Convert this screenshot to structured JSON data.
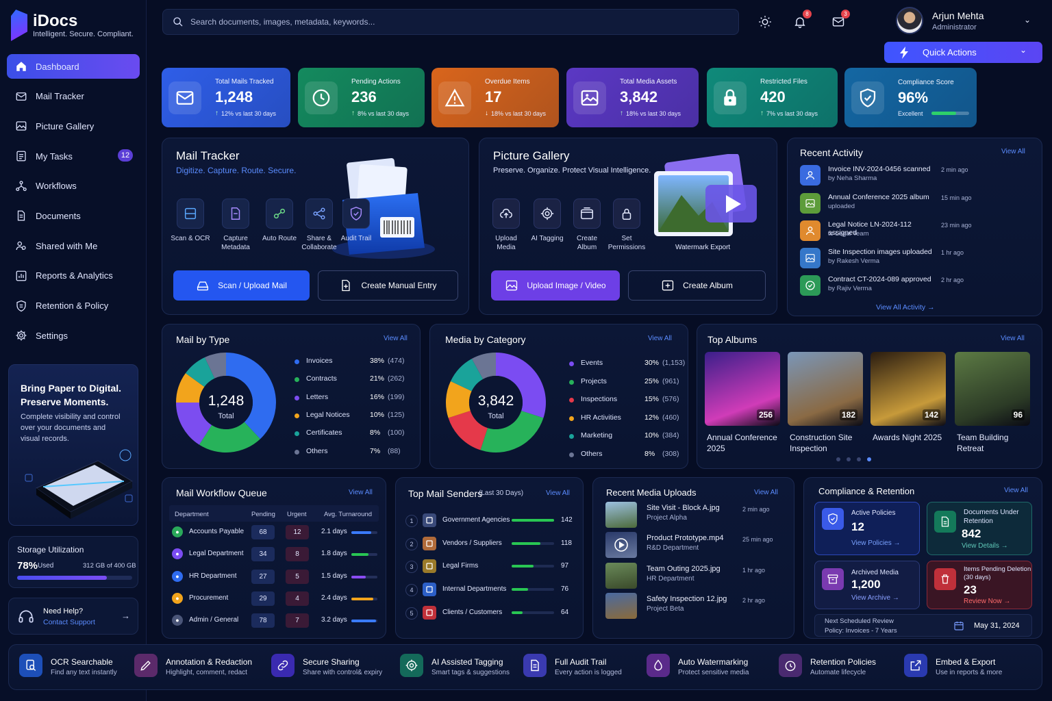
{
  "app": {
    "title": "iDocs",
    "tagline": "Intelligent. Secure. Compliant."
  },
  "sidebar": {
    "items": [
      {
        "label": "Dashboard",
        "icon": "home-icon",
        "active": true
      },
      {
        "label": "Mail Tracker",
        "icon": "mail-icon"
      },
      {
        "label": "Picture Gallery",
        "icon": "image-icon"
      },
      {
        "label": "My Tasks",
        "icon": "tasks-icon",
        "badge": "12"
      },
      {
        "label": "Workflows",
        "icon": "workflow-icon"
      },
      {
        "label": "Documents",
        "icon": "document-icon"
      },
      {
        "label": "Shared with Me",
        "icon": "shared-icon"
      },
      {
        "label": "Reports & Analytics",
        "icon": "reports-icon"
      },
      {
        "label": "Retention & Policy",
        "icon": "shield-icon"
      },
      {
        "label": "Settings",
        "icon": "gear-icon"
      }
    ],
    "promo": {
      "title": "Bring Paper to Digital. Preserve Moments.",
      "text": "Complete visibility and control over your documents and visual records."
    },
    "storage": {
      "title": "Storage Utilization",
      "percent": "78%",
      "used_label": "Used",
      "detail": "312 GB of 400 GB",
      "fill": 0.78
    },
    "help": {
      "title": "Need Help?",
      "link": "Contact Support"
    }
  },
  "topbar": {
    "search_placeholder": "Search documents, images, metadata, keywords...",
    "notifications": "8",
    "messages": "3",
    "user": {
      "name": "Arjun Mehta",
      "role": "Administrator"
    },
    "quick_actions": "Quick Actions"
  },
  "kpis": [
    {
      "label": "Total Mails Tracked",
      "value": "1,248",
      "change": "12% vs last 30 days",
      "dir": "up",
      "color": "#2f5ee8"
    },
    {
      "label": "Pending Actions",
      "value": "236",
      "change": "8% vs last 30 days",
      "dir": "up",
      "color": "#148a5e"
    },
    {
      "label": "Overdue Items",
      "value": "17",
      "change": "18% vs last 30 days",
      "dir": "down",
      "color": "#d9651c"
    },
    {
      "label": "Total Media Assets",
      "value": "3,842",
      "change": "18% vs last 30 days",
      "dir": "up",
      "color": "#5b38c4"
    },
    {
      "label": "Restricted Files",
      "value": "420",
      "change": "7% vs last 30 days",
      "dir": "up",
      "color": "#0f8a7a"
    },
    {
      "label": "Compliance Score",
      "value": "96%",
      "change": "Excellent",
      "dir": "none",
      "color": "#1467a3",
      "fill": 0.96
    }
  ],
  "mail_tracker": {
    "title": "Mail Tracker",
    "subtitle": "Digitize. Capture. Route. Secure.",
    "tools": [
      "Scan & OCR",
      "Capture Metadata",
      "Auto Route",
      "Share & Collaborate",
      "Audit Trail"
    ],
    "primary": "Scan / Upload Mail",
    "secondary": "Create Manual Entry"
  },
  "gallery": {
    "title": "Picture Gallery",
    "subtitle": "Preserve. Organize. Protect Visual Intelligence.",
    "tools": [
      "Upload Media",
      "AI Tagging",
      "Create Album",
      "Set Permissions"
    ],
    "watermark": "Watermark Export",
    "primary": "Upload Image / Video",
    "secondary": "Create Album"
  },
  "activity": {
    "title": "Recent Activity",
    "view_all": "View All",
    "footer": "View All Activity",
    "items": [
      {
        "title": "Invoice INV-2024-0456 scanned",
        "by": "by Neha Sharma",
        "time": "2 min ago",
        "color": "#3a6be0",
        "icon": "user-icon"
      },
      {
        "title": "Annual Conference 2025 album",
        "by": "uploaded",
        "time": "15 min ago",
        "color": "#5d9c3a",
        "icon": "image-icon"
      },
      {
        "title": "Legal Notice LN-2024-112 assigned",
        "by": "to Legal Team",
        "time": "23 min ago",
        "color": "#e08a2e",
        "icon": "user-icon"
      },
      {
        "title": "Site Inspection images uploaded",
        "by": "by Rakesh Verma",
        "time": "1 hr ago",
        "color": "#3577c9",
        "icon": "image-icon"
      },
      {
        "title": "Contract CT-2024-089 approved",
        "by": "by Rajiv Verma",
        "time": "2 hr ago",
        "color": "#2c9a57",
        "icon": "check-icon"
      }
    ]
  },
  "mail_by_type": {
    "title": "Mail by Type",
    "view_all": "View All",
    "total": "1,248",
    "total_label": "Total",
    "items": [
      {
        "name": "Invoices",
        "pct": "38%",
        "count": "(474)",
        "value": 38,
        "color": "#2f6cf0"
      },
      {
        "name": "Contracts",
        "pct": "21%",
        "count": "(262)",
        "value": 21,
        "color": "#27b25a"
      },
      {
        "name": "Letters",
        "pct": "16%",
        "count": "(199)",
        "value": 16,
        "color": "#7c4df0"
      },
      {
        "name": "Legal Notices",
        "pct": "10%",
        "count": "(125)",
        "value": 10,
        "color": "#f2a41c"
      },
      {
        "name": "Certificates",
        "pct": "8%",
        "count": "(100)",
        "value": 8,
        "color": "#1aa39a"
      },
      {
        "name": "Others",
        "pct": "7%",
        "count": "(88)",
        "value": 7,
        "color": "#6b7594"
      }
    ]
  },
  "media_by_category": {
    "title": "Media by Category",
    "view_all": "View All",
    "total": "3,842",
    "total_label": "Total",
    "items": [
      {
        "name": "Events",
        "pct": "30%",
        "count": "(1,153)",
        "value": 30,
        "color": "#7b4cf2"
      },
      {
        "name": "Projects",
        "pct": "25%",
        "count": "(961)",
        "value": 25,
        "color": "#27b25a"
      },
      {
        "name": "Inspections",
        "pct": "15%",
        "count": "(576)",
        "value": 15,
        "color": "#e5394a"
      },
      {
        "name": "HR Activities",
        "pct": "12%",
        "count": "(460)",
        "value": 12,
        "color": "#f2a41c"
      },
      {
        "name": "Marketing",
        "pct": "10%",
        "count": "(384)",
        "value": 10,
        "color": "#1aa39a"
      },
      {
        "name": "Others",
        "pct": "8%",
        "count": "(308)",
        "value": 8,
        "color": "#6b7594"
      }
    ]
  },
  "albums": {
    "title": "Top Albums",
    "view_all": "View All",
    "items": [
      {
        "name": "Annual Conference 2025",
        "count": "256",
        "c1": "#3b1f8a",
        "c2": "#d03cb8"
      },
      {
        "name": "Construction Site Inspection",
        "count": "182",
        "c1": "#7a96b8",
        "c2": "#8a6a44"
      },
      {
        "name": "Awards Night 2025",
        "count": "142",
        "c1": "#2a1c10",
        "c2": "#c79a3a"
      },
      {
        "name": "Team Building Retreat",
        "count": "96",
        "c1": "#5c7a44",
        "c2": "#2c3b26"
      }
    ]
  },
  "queue": {
    "title": "Mail Workflow Queue",
    "view_all": "View All",
    "headers": [
      "Department",
      "Pending",
      "Urgent",
      "Avg. Turnaround"
    ],
    "rows": [
      {
        "dept": "Accounts Payable",
        "pending": "68",
        "urgent": "12",
        "days": "2.1 days",
        "color": "#2aa95a",
        "bar": "#3a7bff",
        "fill": 0.75
      },
      {
        "dept": "Legal Department",
        "pending": "34",
        "urgent": "8",
        "days": "1.8 days",
        "color": "#7b4cf2",
        "bar": "#29c653",
        "fill": 0.65
      },
      {
        "dept": "HR Department",
        "pending": "27",
        "urgent": "5",
        "days": "1.5 days",
        "color": "#2f6cf0",
        "bar": "#8a4cf2",
        "fill": 0.55
      },
      {
        "dept": "Procurement",
        "pending": "29",
        "urgent": "4",
        "days": "2.4 days",
        "color": "#f2a41c",
        "bar": "#f2a41c",
        "fill": 0.85
      },
      {
        "dept": "Admin / General",
        "pending": "78",
        "urgent": "7",
        "days": "3.2 days",
        "color": "#4a5578",
        "bar": "#3a7bff",
        "fill": 0.95
      }
    ]
  },
  "senders": {
    "title": "Top Mail Senders",
    "period": "(Last 30 Days)",
    "view_all": "View All",
    "rows": [
      {
        "rank": "1",
        "name": "Government Agencies",
        "value": "142",
        "fill": 1.0,
        "color": "#3a4a7a"
      },
      {
        "rank": "2",
        "name": "Vendors / Suppliers",
        "value": "118",
        "fill": 0.68,
        "color": "#b06a3a"
      },
      {
        "rank": "3",
        "name": "Legal Firms",
        "value": "97",
        "fill": 0.52,
        "color": "#9a7a2a"
      },
      {
        "rank": "4",
        "name": "Internal Departments",
        "value": "76",
        "fill": 0.38,
        "color": "#2c5fc7"
      },
      {
        "rank": "5",
        "name": "Clients / Customers",
        "value": "64",
        "fill": 0.26,
        "color": "#c0303a"
      }
    ]
  },
  "uploads": {
    "title": "Recent Media Uploads",
    "view_all": "View All",
    "rows": [
      {
        "name": "Site Visit - Block A.jpg",
        "dept": "Project Alpha",
        "time": "2 min ago",
        "c1": "#9cc0e0",
        "c2": "#4c6a3a"
      },
      {
        "name": "Product Prototype.mp4",
        "dept": "R&D Department",
        "time": "25 min ago",
        "c1": "#2a3a6a",
        "c2": "#6a7aa0"
      },
      {
        "name": "Team Outing 2025.jpg",
        "dept": "HR Department",
        "time": "1 hr ago",
        "c1": "#6a8a5a",
        "c2": "#3a4a2a"
      },
      {
        "name": "Safety Inspection 12.jpg",
        "dept": "Project Beta",
        "time": "2 hr ago",
        "c1": "#4a6aa0",
        "c2": "#8a6a3a"
      }
    ]
  },
  "compliance": {
    "title": "Compliance & Retention",
    "view_all": "View All",
    "boxes": [
      {
        "label": "Active Policies",
        "value": "12",
        "link": "View Policies"
      },
      {
        "label": "Documents Under Retention",
        "value": "842",
        "link": "View Details"
      },
      {
        "label": "Archived Media",
        "value": "1,200",
        "link": "View Archive"
      },
      {
        "label": "Items Pending Deletion (30 days)",
        "value": "23",
        "link": "Review Now"
      }
    ],
    "review_title": "Next Scheduled Review",
    "review_policy": "Policy: Invoices - 7 Years",
    "review_date": "May 31, 2024"
  },
  "features": [
    {
      "title": "OCR Searchable",
      "sub": "Find any text instantly",
      "color": "#1d4fb8",
      "icon": "search-doc-icon"
    },
    {
      "title": "Annotation & Redaction",
      "sub": "Highlight, comment, redact",
      "color": "#5b2a6a",
      "icon": "pen-icon"
    },
    {
      "title": "Secure Sharing",
      "sub": "Share with control& expiry",
      "color": "#3a2ab0",
      "icon": "link-icon"
    },
    {
      "title": "AI Assisted Tagging",
      "sub": "Smart tags & suggestions",
      "color": "#146a5a",
      "icon": "ai-gear-icon"
    },
    {
      "title": "Full Audit Trail",
      "sub": "Every action is logged",
      "color": "#3a3ab0",
      "icon": "audit-icon"
    },
    {
      "title": "Auto Watermarking",
      "sub": "Protect sensitive media",
      "color": "#5a2a8a",
      "icon": "watermark-icon"
    },
    {
      "title": "Retention Policies",
      "sub": "Automate lifecycle",
      "color": "#4a2a70",
      "icon": "clock-icon"
    },
    {
      "title": "Embed & Export",
      "sub": "Use in reports & more",
      "color": "#2a3ab0",
      "icon": "export-icon"
    }
  ]
}
